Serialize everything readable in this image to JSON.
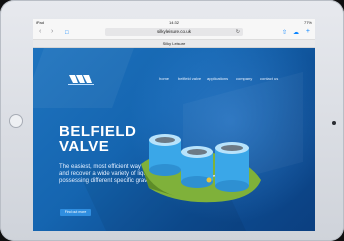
{
  "status": {
    "carrier": "iPad",
    "time": "14:32",
    "battery": "77%"
  },
  "browser": {
    "url": "silkyleisure.co.uk",
    "tab_title": "Silky Leisure"
  },
  "nav": {
    "items": [
      "home",
      "belfield valve",
      "applications",
      "company",
      "contact us"
    ]
  },
  "hero": {
    "title": "BELFIELD VALVE",
    "body": "The easiest, most efficient way to decant and recover a wide variety of liquids possessing different specific gravities.",
    "cta_label": "Find out more"
  },
  "icons": {
    "back": "chevron-left-icon",
    "forward": "chevron-right-icon",
    "bookmarks": "book-icon",
    "reload": "reload-icon",
    "share": "share-icon",
    "tabs": "cloud-tabs-icon",
    "add": "plus-icon"
  },
  "colors": {
    "accent": "#0a84ff",
    "page_blue": "#1565b0",
    "cta_blue": "#2f8ee0",
    "tank": "#39a6e6",
    "grass": "#7fb13a"
  }
}
